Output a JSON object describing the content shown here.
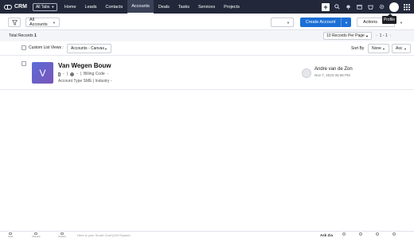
{
  "topnav": {
    "brand": "CRM",
    "all_tabs": "All Tabs",
    "tabs": [
      "Home",
      "Leads",
      "Contacts",
      "Accounts",
      "Deals",
      "Tasks",
      "Services",
      "Projects"
    ],
    "active_tab": "Accounts",
    "bg_color": "#22283a"
  },
  "tooltip": "Profile",
  "toolbar": {
    "view_select": "All Accounts",
    "create_button": "Create Account",
    "actions_button": "Actions",
    "accent_color": "#1b6fd6"
  },
  "records": {
    "total_label": "Total Records",
    "total_count": "1",
    "per_page": "10 Records Per Page",
    "pager": "1 - 1"
  },
  "listbar": {
    "custom_list_views": "Custom List Views :",
    "canvas_select": "Accounts - Canvas",
    "sort_by_label": "Sort By",
    "sort_field": "None",
    "sort_order": "Asc"
  },
  "record": {
    "initial": "V",
    "name": "Van Wegen Bouw",
    "phone": "-",
    "website": "-",
    "billing_code": "Billing Code",
    "billing_code_value": "-",
    "account_type": "Account Type",
    "account_type_value": "SME",
    "industry": "Industry",
    "industry_value": "-",
    "owner": "Andre van de Zon",
    "date": "Nov 7, 2023 05:58 PM"
  },
  "bottombar": {
    "items": [
      "Chats",
      "Channels",
      "Contacts"
    ],
    "smartchat_placeholder": "Here is your Smart Chat (Ctrl+Space)",
    "ask_zia": "Ask Zia"
  }
}
